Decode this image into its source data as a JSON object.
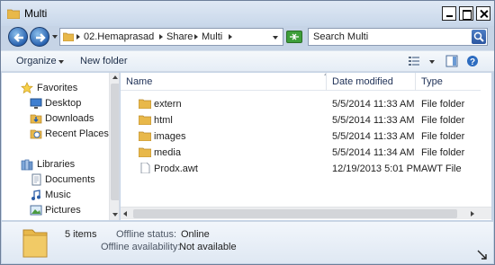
{
  "window": {
    "title": "Multi",
    "icon": "folder-icon"
  },
  "nav": {
    "breadcrumbs": [
      "02.Hemaprasad",
      "Share",
      "Multi"
    ],
    "search_placeholder": "Search Multi"
  },
  "toolbar": {
    "organize_label": "Organize",
    "new_folder_label": "New folder"
  },
  "sidebar": {
    "favorites_label": "Favorites",
    "favorites": [
      {
        "label": "Desktop",
        "icon": "desktop-icon"
      },
      {
        "label": "Downloads",
        "icon": "downloads-icon"
      },
      {
        "label": "Recent Places",
        "icon": "recent-places-icon"
      }
    ],
    "libraries_label": "Libraries",
    "libraries": [
      {
        "label": "Documents",
        "icon": "documents-icon"
      },
      {
        "label": "Music",
        "icon": "music-icon"
      },
      {
        "label": "Pictures",
        "icon": "pictures-icon"
      }
    ]
  },
  "columns": {
    "name": "Name",
    "date": "Date modified",
    "type": "Type"
  },
  "files": [
    {
      "name": "extern",
      "date": "5/5/2014 11:33 AM",
      "type": "File folder",
      "icon": "folder-icon"
    },
    {
      "name": "html",
      "date": "5/5/2014 11:33 AM",
      "type": "File folder",
      "icon": "folder-icon"
    },
    {
      "name": "images",
      "date": "5/5/2014 11:33 AM",
      "type": "File folder",
      "icon": "folder-icon"
    },
    {
      "name": "media",
      "date": "5/5/2014 11:34 AM",
      "type": "File folder",
      "icon": "folder-icon"
    },
    {
      "name": "Prodx.awt",
      "date": "12/19/2013 5:01 PM",
      "type": "AWT File",
      "icon": "file-icon"
    }
  ],
  "details": {
    "item_count": "5 items",
    "offline_status_label": "Offline status:",
    "offline_status_value": "Online",
    "offline_availability_label": "Offline availability:",
    "offline_availability_value": "Not available"
  },
  "colors": {
    "folder": "#e8b84a",
    "accent": "#2a63b0",
    "chrome": "#c6d4e6"
  }
}
